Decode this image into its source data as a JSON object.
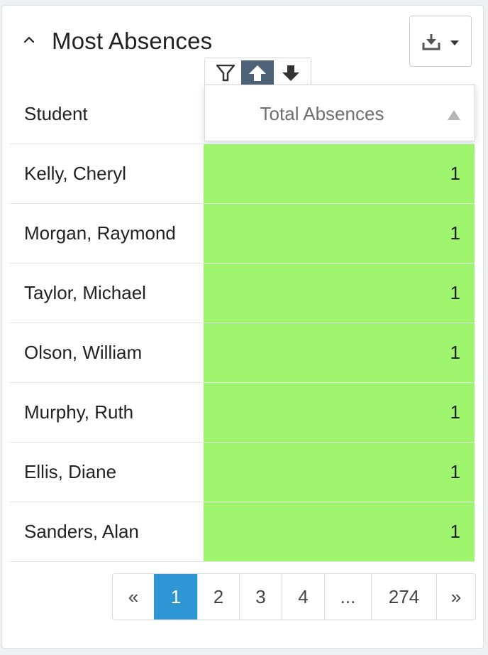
{
  "widget": {
    "title": "Most Absences",
    "export_icon": "download-icon",
    "collapse_icon": "chevron-up-icon"
  },
  "table": {
    "columns": {
      "student": "Student",
      "total": "Total Absences"
    },
    "column_tools": [
      "filter-icon",
      "sort-ascending-icon",
      "sort-descending-icon"
    ],
    "sort_state": "ascending",
    "rows": [
      {
        "name": "Kelly, Cheryl",
        "value": "1"
      },
      {
        "name": "Morgan, Raymond",
        "value": "1"
      },
      {
        "name": "Taylor, Michael",
        "value": "1"
      },
      {
        "name": "Olson, William",
        "value": "1"
      },
      {
        "name": "Murphy, Ruth",
        "value": "1"
      },
      {
        "name": "Ellis, Diane",
        "value": "1"
      },
      {
        "name": "Sanders, Alan",
        "value": "1"
      }
    ]
  },
  "pagination": {
    "prev": "«",
    "pages": [
      "1",
      "2",
      "3",
      "4",
      "...",
      "274"
    ],
    "next": "»",
    "current": "1"
  },
  "colors": {
    "highlight": "#a0f56f",
    "active_page": "#2e96d3",
    "active_tool": "#4e6378"
  }
}
